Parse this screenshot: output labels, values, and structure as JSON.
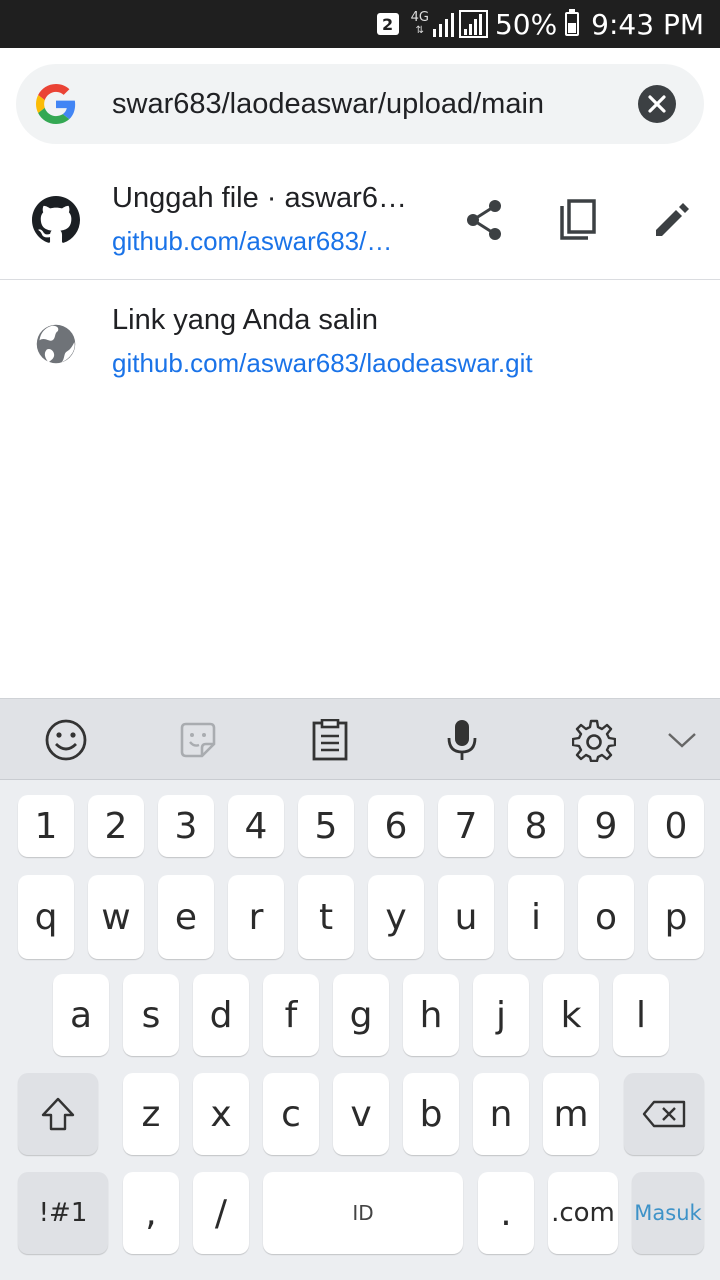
{
  "status_bar": {
    "sim_badge": "2",
    "network": "4G",
    "battery": "50%",
    "battery_level": 0.5,
    "time": "9:43 PM"
  },
  "omnibox": {
    "url_text": "swar683/laodeaswar/upload/main",
    "leading_icon": "google-g-icon",
    "clear_icon": "close-icon"
  },
  "suggestions": [
    {
      "icon": "github-icon",
      "title": "Unggah file · aswar6…",
      "url": "github.com/aswar683/…",
      "actions": [
        "share-icon",
        "copy-icon",
        "edit-icon"
      ]
    },
    {
      "icon": "globe-icon",
      "title": "Link yang Anda salin",
      "url": "github.com/aswar683/laodeaswar.git"
    }
  ],
  "keyboard": {
    "toolbar": [
      "emoji-icon",
      "sticker-icon",
      "clipboard-icon",
      "microphone-icon",
      "settings-icon",
      "chevron-down-icon"
    ],
    "row_numbers": [
      "1",
      "2",
      "3",
      "4",
      "5",
      "6",
      "7",
      "8",
      "9",
      "0"
    ],
    "row_q": [
      "q",
      "w",
      "e",
      "r",
      "t",
      "y",
      "u",
      "i",
      "o",
      "p"
    ],
    "row_a": [
      "a",
      "s",
      "d",
      "f",
      "g",
      "h",
      "j",
      "k",
      "l"
    ],
    "row_z": [
      "z",
      "x",
      "c",
      "v",
      "b",
      "n",
      "m"
    ],
    "symbols": "!#1",
    "comma": ",",
    "slash": "/",
    "space": "ID",
    "period": ".",
    "dotcom": ".com",
    "enter": "Masuk"
  },
  "colors": {
    "link": "#1a73e8",
    "omnibox_bg": "#f1f3f4",
    "enter_text": "#3d92c8"
  }
}
